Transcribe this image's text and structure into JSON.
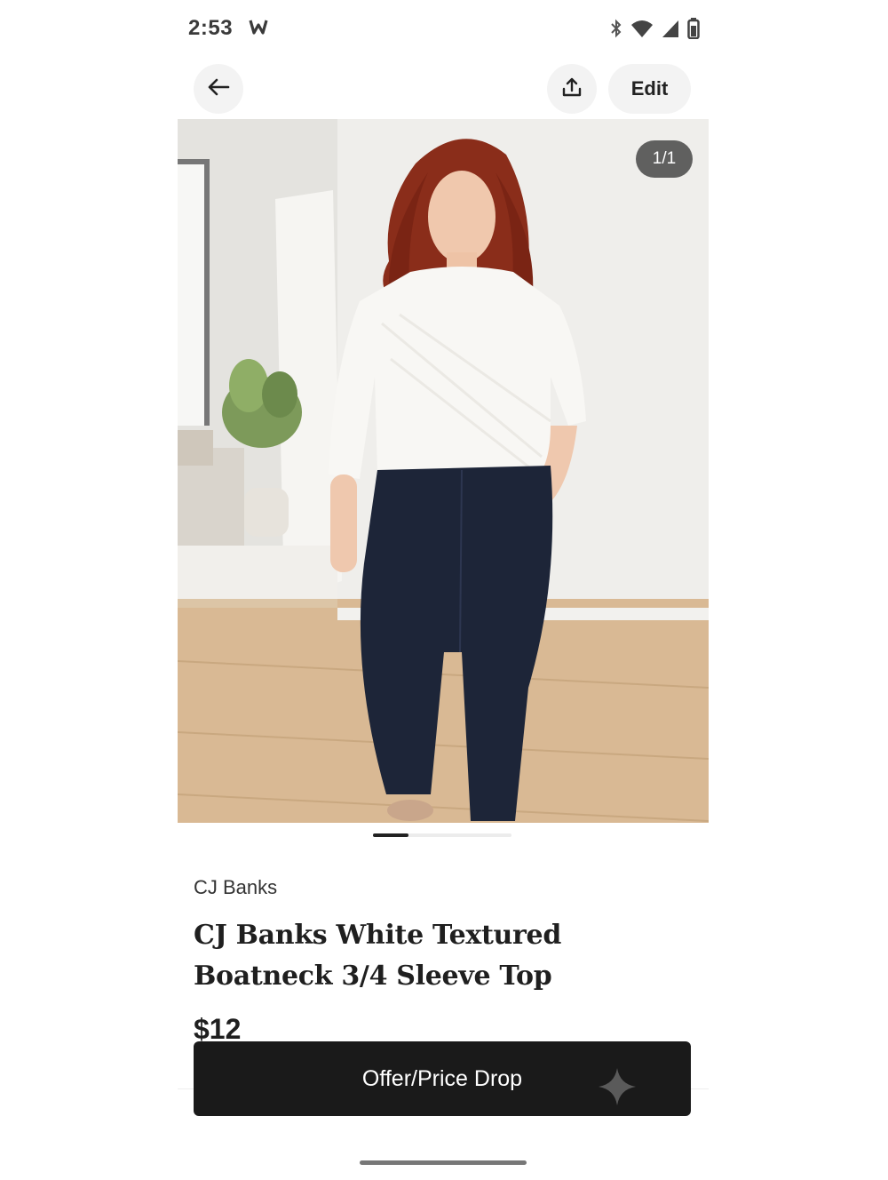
{
  "status_bar": {
    "time": "2:53",
    "icons": [
      "heart-notification-icon",
      "bluetooth-icon",
      "wifi-icon",
      "signal-icon",
      "battery-icon"
    ]
  },
  "top_bar": {
    "back_icon": "arrow-left-icon",
    "share_icon": "share-upload-icon",
    "edit_label": "Edit"
  },
  "photo": {
    "counter": "1/1",
    "indicator_position": 1,
    "indicator_total": 1
  },
  "listing": {
    "brand": "CJ Banks",
    "title": "CJ Banks White Textured Boatneck 3/4 Sleeve Top",
    "price": "$12"
  },
  "offer_button": {
    "label": "Offer/Price Drop",
    "icon": "sparkle-icon"
  },
  "colors": {
    "button_bg": "#1a1a1a",
    "counter_bg": "#464646",
    "icon_button_bg": "#f3f3f3"
  }
}
